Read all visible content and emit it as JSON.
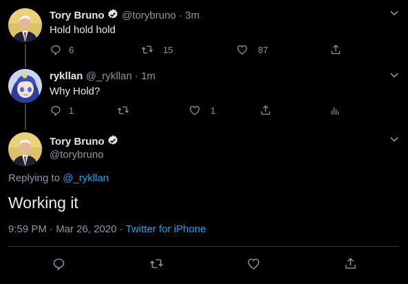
{
  "tweets": [
    {
      "name": "Tory Bruno",
      "handle": "@torybruno",
      "time": "3m",
      "text": "Hold hold hold",
      "replies": "6",
      "retweets": "15",
      "likes": "87"
    },
    {
      "name": "rykllan",
      "handle": "@_rykllan",
      "time": "1m",
      "text": "Why Hold?",
      "replies": "1",
      "retweets": "",
      "likes": "1"
    }
  ],
  "main_tweet": {
    "name": "Tory Bruno",
    "handle": "@torybruno",
    "replying_prefix": "Replying to",
    "replying_to": "@_rykllan",
    "text": "Working it",
    "timestamp": "9:59 PM · Mar 26, 2020 · ",
    "source": "Twitter for iPhone"
  },
  "separator": " · ",
  "colors": {
    "background": "#000000",
    "accent": "#1da1f2",
    "secondary_text": "#8b98a5",
    "divider": "#2f3336"
  },
  "icons": [
    "reply-icon",
    "retweet-icon",
    "like-icon",
    "share-icon",
    "analytics-icon",
    "verified-badge-icon",
    "chevron-down-icon"
  ]
}
